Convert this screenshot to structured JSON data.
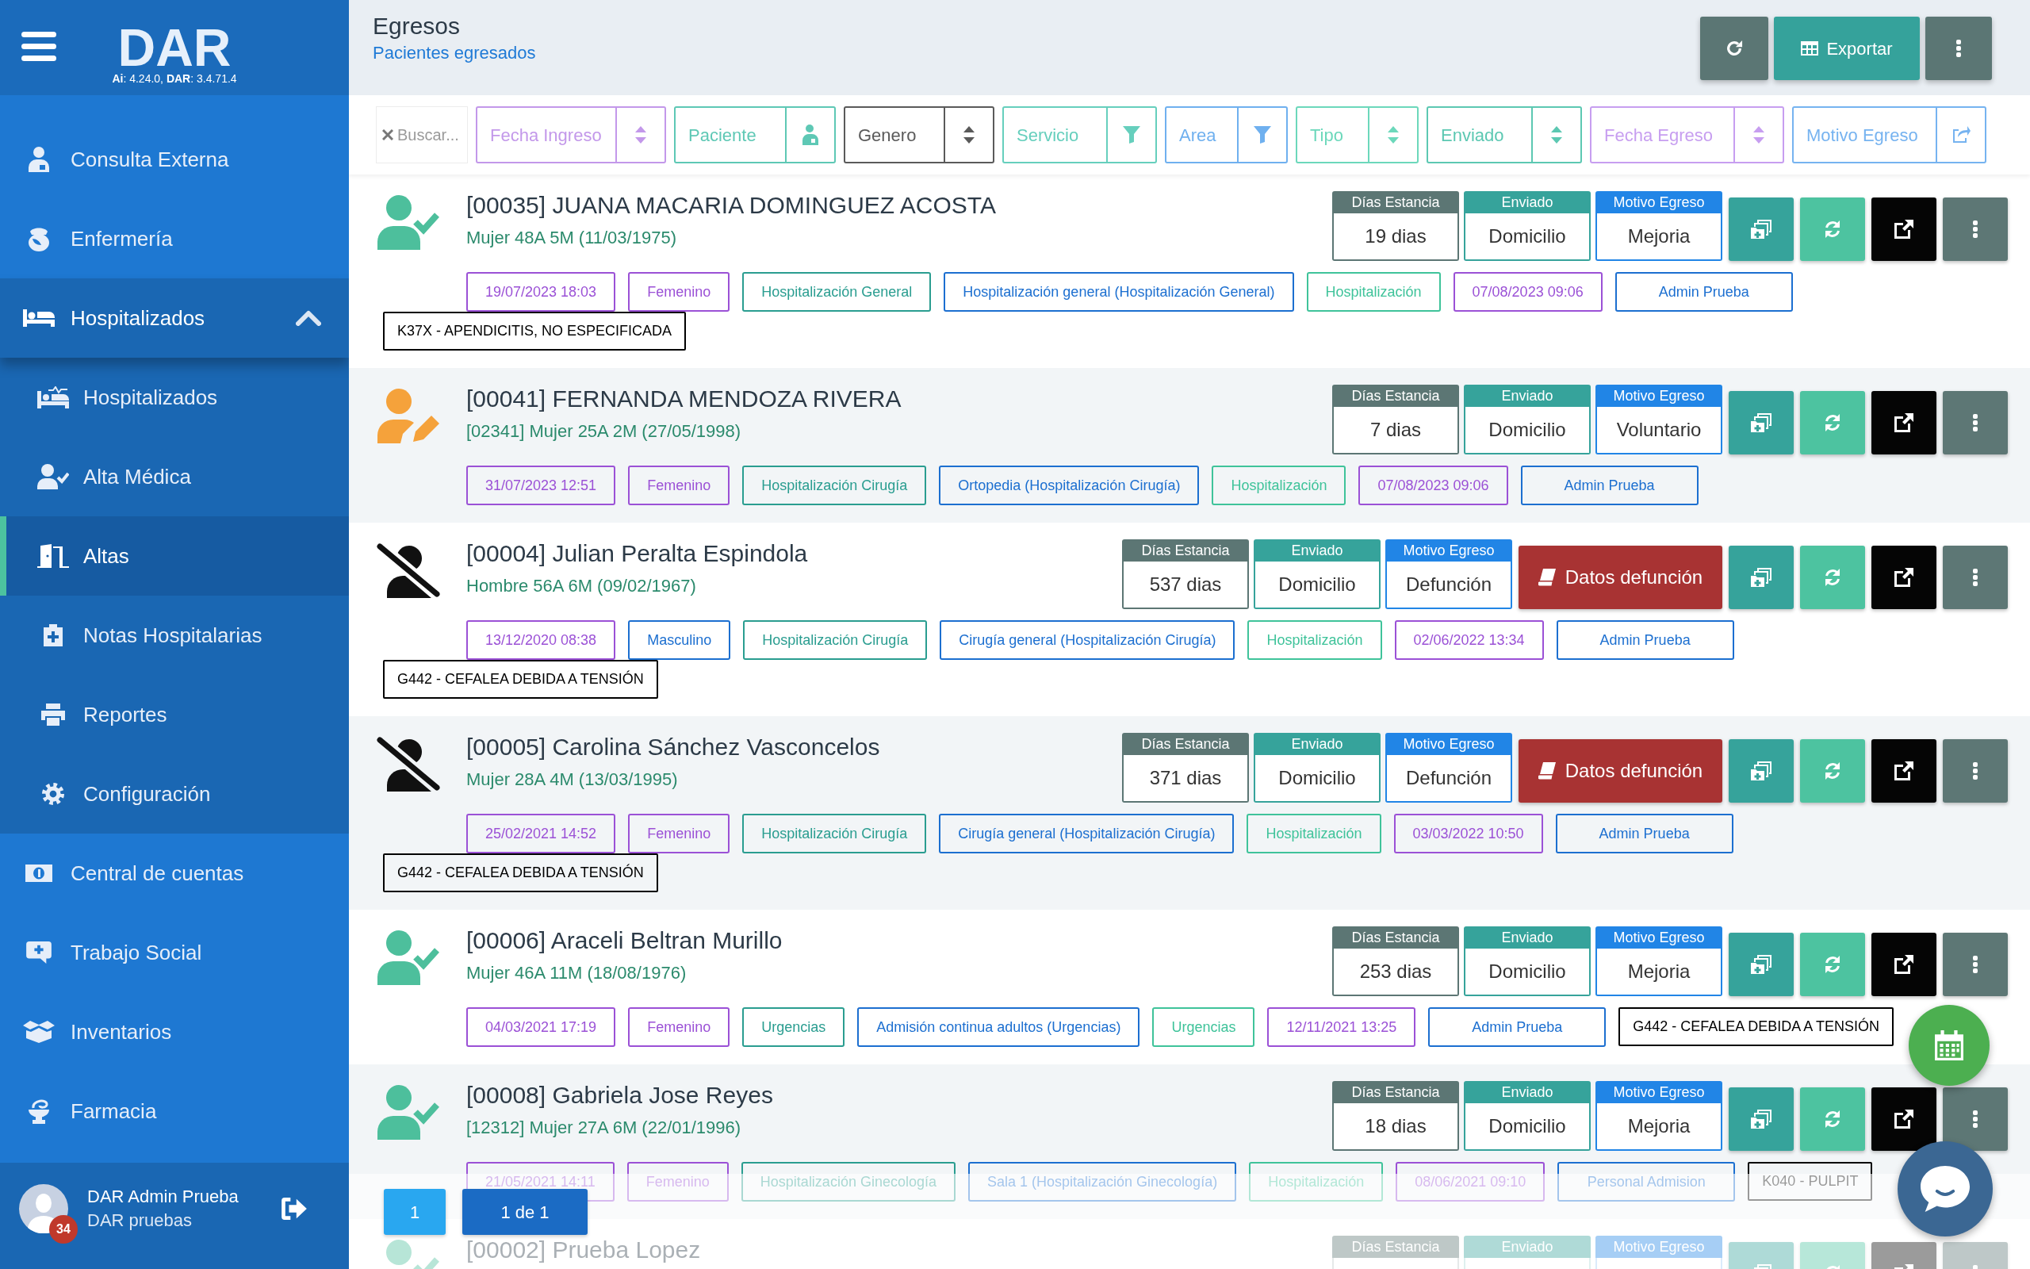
{
  "sidebar": {
    "logo": "DAR",
    "version": "**Ai**: 4.24.0, **DAR**: 3.4.71.4",
    "items": [
      {
        "label": "Consulta Externa",
        "selected": false
      },
      {
        "label": "Enfermería",
        "selected": false
      },
      {
        "label": "Hospitalizados",
        "selected": false,
        "expanded": true,
        "children": [
          {
            "label": "Hospitalizados",
            "selected": false
          },
          {
            "label": "Alta Médica",
            "selected": false
          },
          {
            "label": "Altas",
            "selected": true
          },
          {
            "label": "Notas Hospitalarias",
            "selected": false
          },
          {
            "label": "Reportes",
            "selected": false
          },
          {
            "label": "Configuración",
            "selected": false
          }
        ]
      },
      {
        "label": "Central de cuentas",
        "selected": false
      },
      {
        "label": "Trabajo Social",
        "selected": false
      },
      {
        "label": "Inventarios",
        "selected": false
      },
      {
        "label": "Farmacia",
        "selected": false
      }
    ],
    "user": {
      "name": "DAR Admin Prueba",
      "organization": "DAR pruebas",
      "notifications": "34"
    }
  },
  "header": {
    "title": "Egresos",
    "subtitle": "Pacientes egresados",
    "export_button": "Exportar"
  },
  "filters": {
    "search_placeholder": "Buscar...",
    "columns": [
      {
        "label": "Fecha Ingreso",
        "color": "#c398ea",
        "kind": "sort"
      },
      {
        "label": "Paciente",
        "color": "#5ec8b5",
        "kind": "person"
      },
      {
        "label": "Genero",
        "color": "#5a5a5a",
        "kind": "sort"
      },
      {
        "label": "Servicio",
        "color": "#66cfbd",
        "kind": "filter"
      },
      {
        "label": "Area",
        "color": "#6fb0ef",
        "kind": "filter"
      },
      {
        "label": "Tipo",
        "color": "#6cd8bb",
        "kind": "sort"
      },
      {
        "label": "Enviado",
        "color": "#5cc8b2",
        "kind": "sort"
      },
      {
        "label": "Fecha Egreso",
        "color": "#c79ef0",
        "kind": "sort"
      },
      {
        "label": "Motivo Egreso",
        "color": "#76b3f0",
        "kind": "share"
      }
    ]
  },
  "rows": [
    {
      "kind": "check",
      "name": "[00035] JUANA MACARIA DOMINGUEZ ACOSTA",
      "details": "Mujer 48A 5M (11/03/1975)",
      "stats": [
        {
          "label": "Días Estancia",
          "value": "19 dias",
          "color": "#5c7674"
        },
        {
          "label": "Enviado",
          "value": "Domicilio",
          "color": "#36a39b"
        },
        {
          "label": "Motivo Egreso",
          "value": "Mejoria",
          "color": "#2185e6"
        }
      ],
      "tags": [
        {
          "text": "19/07/2023 18:03",
          "color": "#9b51d6"
        },
        {
          "text": "Femenino",
          "color": "#9b51d6"
        },
        {
          "text": "Hospitalización General",
          "color": "#2a9d90"
        },
        {
          "text": "Hospitalización general (Hospitalización General)",
          "color": "#1c6fd0"
        },
        {
          "text": "Hospitalización",
          "color": "#3fc39a"
        },
        {
          "text": "07/08/2023 09:06",
          "color": "#9b51d6"
        },
        {
          "text": "Admin Prueba",
          "color": "#1c6fd0"
        }
      ],
      "diagnosis": "K37X - APENDICITIS, NO ESPECIFICADA"
    },
    {
      "kind": "edit",
      "name": "[00041] FERNANDA MENDOZA RIVERA",
      "details": "[02341] Mujer 25A 2M (27/05/1998)",
      "stats": [
        {
          "label": "Días Estancia",
          "value": "7 dias",
          "color": "#5c7674"
        },
        {
          "label": "Enviado",
          "value": "Domicilio",
          "color": "#36a39b"
        },
        {
          "label": "Motivo Egreso",
          "value": "Voluntario",
          "color": "#2185e6"
        }
      ],
      "tags": [
        {
          "text": "31/07/2023 12:51",
          "color": "#9b51d6"
        },
        {
          "text": "Femenino",
          "color": "#9b51d6"
        },
        {
          "text": "Hospitalización Cirugía",
          "color": "#2a9d90"
        },
        {
          "text": "Ortopedia (Hospitalización Cirugía)",
          "color": "#1c6fd0"
        },
        {
          "text": "Hospitalización",
          "color": "#3fc39a"
        },
        {
          "text": "07/08/2023 09:06",
          "color": "#9b51d6"
        },
        {
          "text": "Admin Prueba",
          "color": "#1c6fd0"
        }
      ]
    },
    {
      "kind": "deceased",
      "name": "[00004] Julian Peralta Espindola",
      "details": "Hombre 56A 6M (09/02/1967)",
      "stats": [
        {
          "label": "Días Estancia",
          "value": "537 dias",
          "color": "#5c7674"
        },
        {
          "label": "Enviado",
          "value": "Domicilio",
          "color": "#36a39b"
        },
        {
          "label": "Motivo Egreso",
          "value": "Defunción",
          "color": "#2185e6"
        }
      ],
      "death_button": "Datos defunción",
      "tags": [
        {
          "text": "13/12/2020 08:38",
          "color": "#9b51d6"
        },
        {
          "text": "Masculino",
          "color": "#1c6fd0"
        },
        {
          "text": "Hospitalización Cirugía",
          "color": "#2a9d90"
        },
        {
          "text": "Cirugía general (Hospitalización Cirugía)",
          "color": "#1c6fd0"
        },
        {
          "text": "Hospitalización",
          "color": "#3fc39a"
        },
        {
          "text": "02/06/2022 13:34",
          "color": "#9b51d6"
        },
        {
          "text": "Admin Prueba",
          "color": "#1c6fd0"
        }
      ],
      "diagnosis": "G442 - CEFALEA DEBIDA A TENSIÓN"
    },
    {
      "kind": "deceased",
      "name": "[00005] Carolina Sánchez Vasconcelos",
      "details": "Mujer 28A 4M (13/03/1995)",
      "stats": [
        {
          "label": "Días Estancia",
          "value": "371 dias",
          "color": "#5c7674"
        },
        {
          "label": "Enviado",
          "value": "Domicilio",
          "color": "#36a39b"
        },
        {
          "label": "Motivo Egreso",
          "value": "Defunción",
          "color": "#2185e6"
        }
      ],
      "death_button": "Datos defunción",
      "tags": [
        {
          "text": "25/02/2021 14:52",
          "color": "#9b51d6"
        },
        {
          "text": "Femenino",
          "color": "#9b51d6"
        },
        {
          "text": "Hospitalización Cirugía",
          "color": "#2a9d90"
        },
        {
          "text": "Cirugía general (Hospitalización Cirugía)",
          "color": "#1c6fd0"
        },
        {
          "text": "Hospitalización",
          "color": "#3fc39a"
        },
        {
          "text": "03/03/2022 10:50",
          "color": "#9b51d6"
        },
        {
          "text": "Admin Prueba",
          "color": "#1c6fd0"
        }
      ],
      "diagnosis": "G442 - CEFALEA DEBIDA A TENSIÓN"
    },
    {
      "kind": "check",
      "name": "[00006] Araceli Beltran Murillo",
      "details": "Mujer 46A 11M (18/08/1976)",
      "stats": [
        {
          "label": "Días Estancia",
          "value": "253 dias",
          "color": "#5c7674"
        },
        {
          "label": "Enviado",
          "value": "Domicilio",
          "color": "#36a39b"
        },
        {
          "label": "Motivo Egreso",
          "value": "Mejoria",
          "color": "#2185e6"
        }
      ],
      "tags": [
        {
          "text": "04/03/2021 17:19",
          "color": "#9b51d6"
        },
        {
          "text": "Femenino",
          "color": "#9b51d6"
        },
        {
          "text": "Urgencias",
          "color": "#2a9d90"
        },
        {
          "text": "Admisión continua adultos (Urgencias)",
          "color": "#1c6fd0"
        },
        {
          "text": "Urgencias",
          "color": "#3fc39a"
        },
        {
          "text": "12/11/2021 13:25",
          "color": "#9b51d6"
        },
        {
          "text": "Admin Prueba",
          "color": "#1c6fd0"
        }
      ],
      "diagnosis": "G442 - CEFALEA DEBIDA A TENSIÓN"
    },
    {
      "kind": "check",
      "name": "[00008] Gabriela Jose Reyes",
      "details": "[12312] Mujer 27A 6M (22/01/1996)",
      "stats": [
        {
          "label": "Días Estancia",
          "value": "18 dias",
          "color": "#5c7674"
        },
        {
          "label": "Enviado",
          "value": "Domicilio",
          "color": "#36a39b"
        },
        {
          "label": "Motivo Egreso",
          "value": "Mejoria",
          "color": "#2185e6"
        }
      ],
      "tags": [
        {
          "text": "21/05/2021 14:11",
          "color": "#9b51d6"
        },
        {
          "text": "Femenino",
          "color": "#9b51d6"
        },
        {
          "text": "Hospitalización Ginecología",
          "color": "#2a9d90"
        },
        {
          "text": "Sala 1 (Hospitalización Ginecología)",
          "color": "#1c6fd0"
        },
        {
          "text": "Hospitalización",
          "color": "#3fc39a"
        },
        {
          "text": "08/06/2021 09:10",
          "color": "#9b51d6"
        },
        {
          "text": "Personal Admision",
          "color": "#1c6fd0"
        }
      ],
      "diagnosis": "K040 - PULPIT"
    },
    {
      "kind": "check",
      "name": "[00002] Prueba Lopez",
      "stats": [
        {
          "label": "Días Estancia",
          "color": "#bec8c7"
        },
        {
          "label": "Enviado",
          "color": "#afdad7"
        },
        {
          "label": "Motivo Egreso",
          "color": "#a6cef5"
        }
      ]
    }
  ],
  "pagination": {
    "pages": [
      {
        "label": "1",
        "selected": true
      }
    ],
    "summary": "1 de 1"
  }
}
